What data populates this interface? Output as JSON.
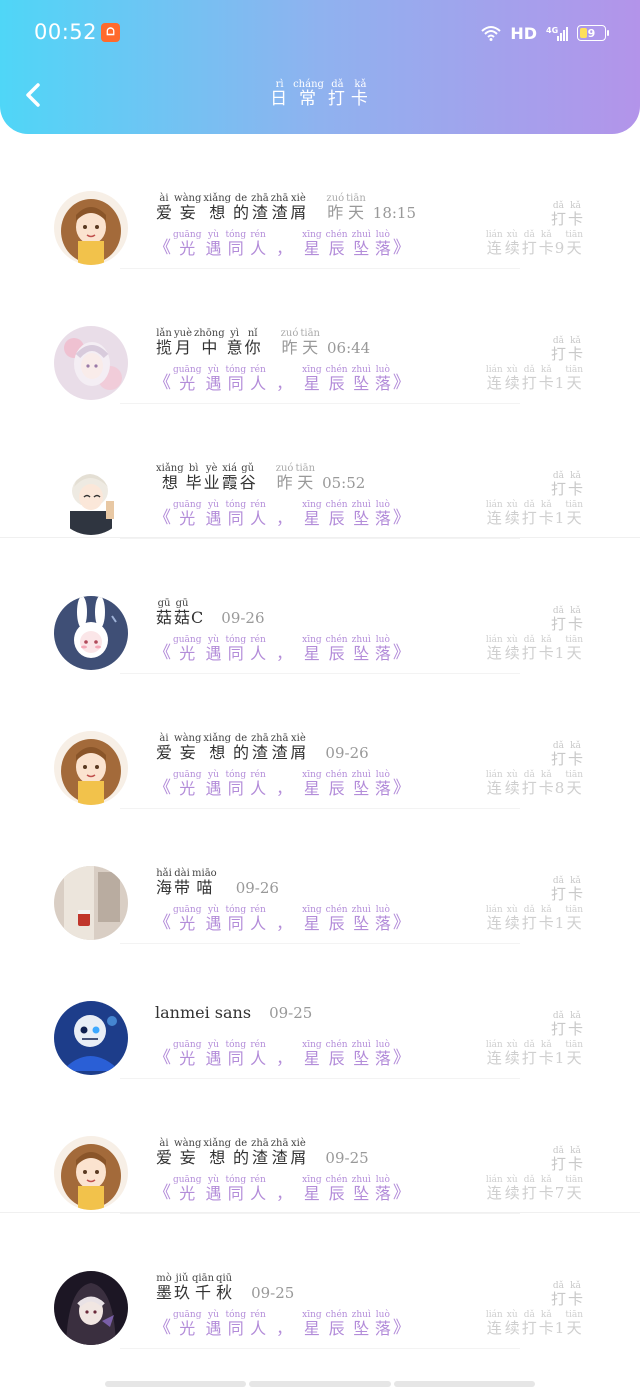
{
  "status_bar": {
    "time": "00:52",
    "network": "HD",
    "signal": "4G",
    "battery": "9"
  },
  "header": {
    "title": [
      {
        "py": "rì",
        "hz": "日"
      },
      {
        "py": "cháng",
        "hz": "常"
      },
      {
        "py": "dǎ",
        "hz": "打"
      },
      {
        "py": "kǎ",
        "hz": "卡"
      }
    ]
  },
  "topic": {
    "open": "《",
    "close": "》",
    "sep": "，",
    "part1": [
      {
        "py": "guāng",
        "hz": "光"
      },
      {
        "py": "yù",
        "hz": "遇"
      },
      {
        "py": "tóng",
        "hz": "同"
      },
      {
        "py": "rén",
        "hz": "人"
      }
    ],
    "part2": [
      {
        "py": "xīng",
        "hz": "星"
      },
      {
        "py": "chén",
        "hz": "辰"
      },
      {
        "py": "zhuì",
        "hz": "坠"
      },
      {
        "py": "luò",
        "hz": "落"
      }
    ]
  },
  "checkin_label": [
    {
      "py": "dǎ",
      "hz": "打"
    },
    {
      "py": "kǎ",
      "hz": "卡"
    }
  ],
  "streak_label": {
    "before": [
      {
        "py": "lián",
        "hz": "连"
      },
      {
        "py": "xù",
        "hz": "续"
      },
      {
        "py": "dǎ",
        "hz": "打"
      },
      {
        "py": "kǎ",
        "hz": "卡"
      }
    ],
    "after": [
      {
        "py": "tiān",
        "hz": "天"
      }
    ]
  },
  "entries": [
    {
      "name": [
        {
          "py": "ài",
          "hz": "爱"
        },
        {
          "py": "wàng",
          "hz": "妄"
        },
        {
          "py": "xiǎng",
          "hz": "想"
        },
        {
          "py": "de",
          "hz": "的"
        },
        {
          "py": "zhā",
          "hz": "渣"
        },
        {
          "py": "zhā",
          "hz": "渣"
        },
        {
          "py": "xiè",
          "hz": "屑"
        }
      ],
      "time_prefix": [
        {
          "py": "zuó",
          "hz": "昨"
        },
        {
          "py": "tiān",
          "hz": "天"
        }
      ],
      "time": "18:15",
      "days": "9",
      "avatar": "girl-brown-hair"
    },
    {
      "name": [
        {
          "py": "lǎn",
          "hz": "揽"
        },
        {
          "py": "yuè",
          "hz": "月"
        },
        {
          "py": "zhōng",
          "hz": "中"
        },
        {
          "py": "yì",
          "hz": "意"
        },
        {
          "py": "nǐ",
          "hz": "你"
        }
      ],
      "time_prefix": [
        {
          "py": "zuó",
          "hz": "昨"
        },
        {
          "py": "tiān",
          "hz": "天"
        }
      ],
      "time": "06:44",
      "days": "1",
      "avatar": "pale-girl-flowers"
    },
    {
      "name": [
        {
          "py": "xiǎng",
          "hz": "想"
        },
        {
          "py": "bì",
          "hz": "毕"
        },
        {
          "py": "yè",
          "hz": "业"
        },
        {
          "py": "xiá",
          "hz": "霞"
        },
        {
          "py": "gǔ",
          "hz": "谷"
        }
      ],
      "time_prefix": [
        {
          "py": "zuó",
          "hz": "昨"
        },
        {
          "py": "tiān",
          "hz": "天"
        }
      ],
      "time": "05:52",
      "days": "1",
      "avatar": "white-hair-boy"
    },
    {
      "name": [
        {
          "py": "gū",
          "hz": "菇"
        },
        {
          "py": "gū",
          "hz": "菇"
        }
      ],
      "name_suffix": "C",
      "time_prefix": [],
      "time": "09-26",
      "days": "1",
      "avatar": "bunny-girl"
    },
    {
      "name": [
        {
          "py": "ài",
          "hz": "爱"
        },
        {
          "py": "wàng",
          "hz": "妄"
        },
        {
          "py": "xiǎng",
          "hz": "想"
        },
        {
          "py": "de",
          "hz": "的"
        },
        {
          "py": "zhā",
          "hz": "渣"
        },
        {
          "py": "zhā",
          "hz": "渣"
        },
        {
          "py": "xiè",
          "hz": "屑"
        }
      ],
      "time_prefix": [],
      "time": "09-26",
      "days": "8",
      "avatar": "girl-brown-hair"
    },
    {
      "name": [
        {
          "py": "hǎi",
          "hz": "海"
        },
        {
          "py": "dài",
          "hz": "带"
        },
        {
          "py": "miāo",
          "hz": "喵"
        }
      ],
      "time_prefix": [],
      "time": "09-26",
      "days": "1",
      "avatar": "cup-photo"
    },
    {
      "name": [],
      "plain_name": "lanmei sans",
      "time_prefix": [],
      "time": "09-25",
      "days": "1",
      "avatar": "blue-skeleton"
    },
    {
      "name": [
        {
          "py": "ài",
          "hz": "爱"
        },
        {
          "py": "wàng",
          "hz": "妄"
        },
        {
          "py": "xiǎng",
          "hz": "想"
        },
        {
          "py": "de",
          "hz": "的"
        },
        {
          "py": "zhā",
          "hz": "渣"
        },
        {
          "py": "zhā",
          "hz": "渣"
        },
        {
          "py": "xiè",
          "hz": "屑"
        }
      ],
      "time_prefix": [],
      "time": "09-25",
      "days": "7",
      "avatar": "girl-brown-hair"
    },
    {
      "name": [
        {
          "py": "mò",
          "hz": "墨"
        },
        {
          "py": "jiǔ",
          "hz": "玖"
        },
        {
          "py": "qiān",
          "hz": "千"
        },
        {
          "py": "qiū",
          "hz": "秋"
        }
      ],
      "time_prefix": [],
      "time": "09-25",
      "days": "1",
      "avatar": "dark-hood-girl"
    }
  ],
  "colors": {
    "header_start": "#4fd6f7",
    "header_end": "#b394ea",
    "topic": "#b38cd9",
    "muted": "#c8c8c8"
  }
}
